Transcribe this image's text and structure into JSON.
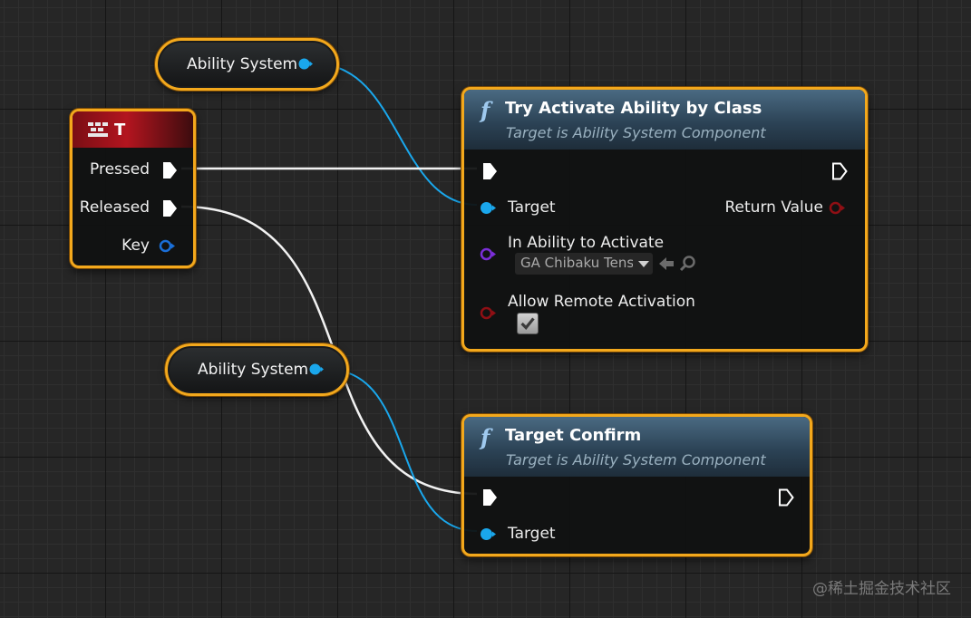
{
  "nodes": {
    "ability_system_top": {
      "label": "Ability System"
    },
    "ability_system_bottom": {
      "label": "Ability System"
    },
    "input_t": {
      "title": "T",
      "pins": {
        "pressed": "Pressed",
        "released": "Released",
        "key": "Key"
      }
    },
    "try_activate": {
      "title": "Try Activate Ability by Class",
      "subtitle": "Target is Ability System Component",
      "pins": {
        "target": "Target",
        "return_value": "Return Value",
        "in_ability": "In Ability to Activate",
        "in_ability_value": "GA Chibaku Tensei",
        "allow_remote": "Allow Remote Activation",
        "allow_remote_checked": true
      }
    },
    "target_confirm": {
      "title": "Target Confirm",
      "subtitle": "Target is Ability System Component",
      "pins": {
        "target": "Target"
      }
    }
  },
  "watermark": "@稀土掘金技术社区",
  "colors": {
    "node_border": "#f3a81c",
    "object_pin": "#1aa7ec",
    "class_pin": "#7b2ed9",
    "bool_pin": "#8f0f14",
    "struct_pin": "#1a6fd8",
    "exec_pin": "#ffffff",
    "input_event_header": "#b3151f",
    "function_header": "#3b5a70"
  },
  "icons": {
    "function": "function-f-icon",
    "input_key": "keyboard-icon",
    "dropdown": "chevron-down-icon",
    "use_selected": "arrow-left-icon",
    "browse": "search-icon",
    "checkbox": "checkmark-icon"
  }
}
